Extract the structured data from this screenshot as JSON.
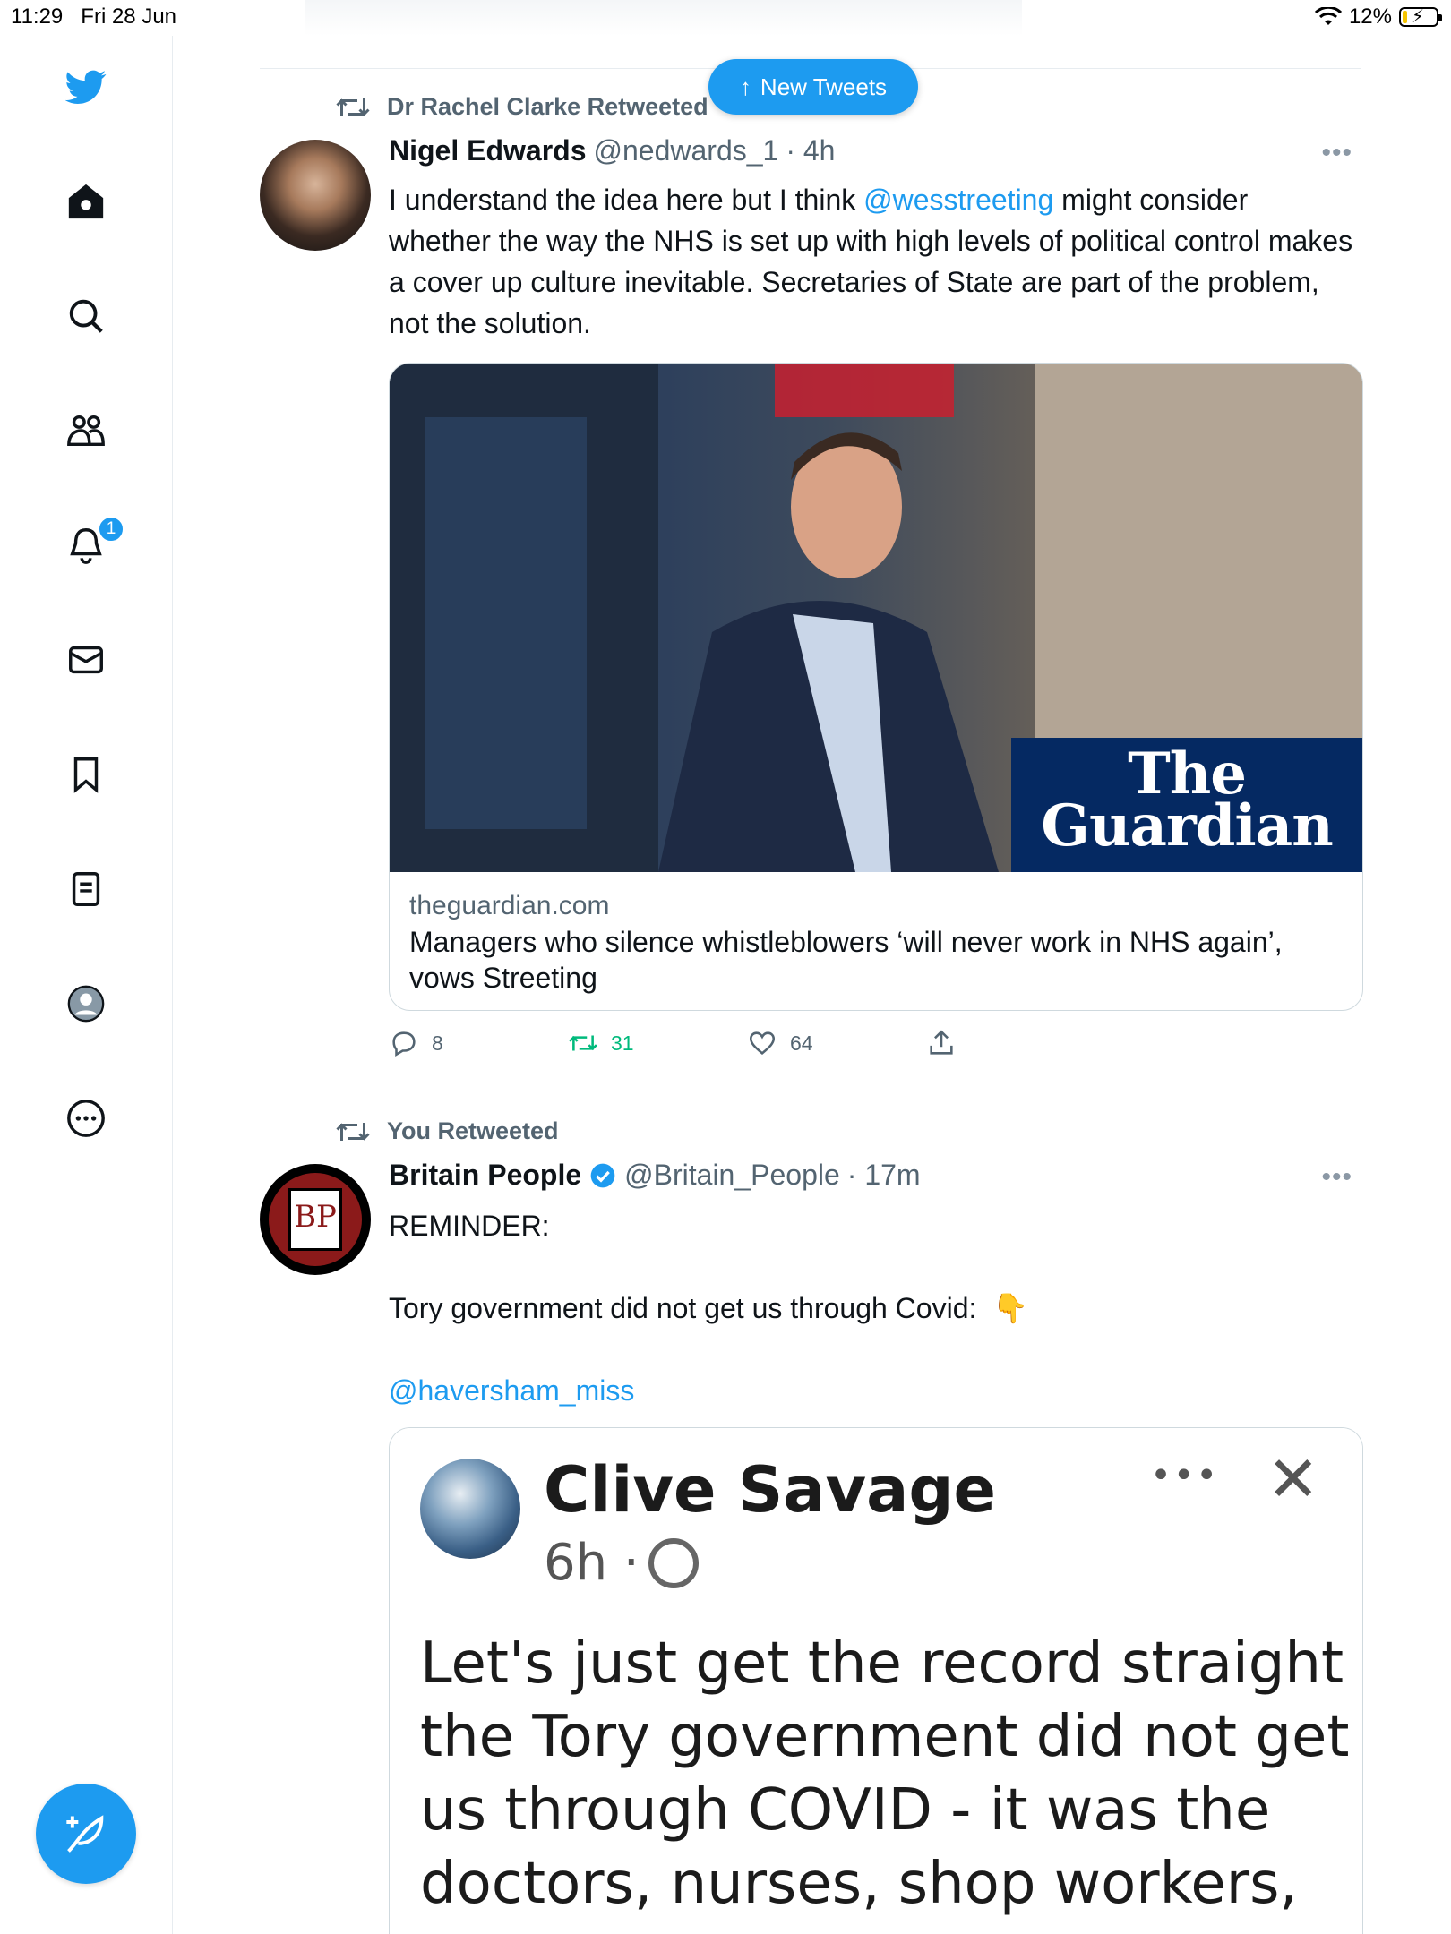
{
  "status_bar": {
    "time": "11:29",
    "date": "Fri 28 Jun",
    "battery": "12%",
    "battery_level": 0.12
  },
  "sidebar": {
    "items": [
      {
        "name": "twitter-logo",
        "icon": "twitter-bird"
      },
      {
        "name": "home",
        "icon": "home-icon"
      },
      {
        "name": "explore",
        "icon": "search-icon"
      },
      {
        "name": "communities",
        "icon": "people-icon"
      },
      {
        "name": "notifications",
        "icon": "bell-icon",
        "badge": "1"
      },
      {
        "name": "messages",
        "icon": "mail-icon"
      },
      {
        "name": "bookmarks",
        "icon": "bookmark-icon"
      },
      {
        "name": "lists",
        "icon": "list-icon"
      },
      {
        "name": "profile",
        "icon": "avatar-icon"
      },
      {
        "name": "more",
        "icon": "more-circle-icon"
      }
    ],
    "compose_icon": "compose-feather-icon"
  },
  "new_tweets": {
    "label": "New Tweets",
    "icon": "arrow-up-icon"
  },
  "tweets": [
    {
      "retweet_by": "Dr Rachel Clarke Retweeted",
      "name": "Nigel Edwards",
      "handle": "@nedwards_1",
      "time": "· 4h",
      "text_before": "I understand the idea here but I think ",
      "mention": "@wesstreeting",
      "text_after": " might consider whether the way the NHS is set up with high levels of political control makes a cover up culture inevitable.  Secretaries of State are part of the problem, not the solution.",
      "card": {
        "domain": "theguardian.com",
        "title": "Managers who silence whistleblowers ‘will never work in NHS again’, vows Streeting",
        "logo_line1": "The",
        "logo_line2": "Guardian"
      },
      "replies": "8",
      "retweets": "31",
      "likes": "64"
    },
    {
      "retweet_by": "You Retweeted",
      "name": "Britain People",
      "handle": "@Britain_People",
      "time": "· 17m",
      "avatar_text": "BP",
      "line1": "REMINDER:",
      "line2": "Tory government did not get us through Covid:",
      "emoji": "👇",
      "mention": "@haversham_miss",
      "embed": {
        "name": "Clive Savage",
        "time": "6h ·",
        "dots": "•••",
        "close": "✕",
        "text": "Let's just get the record straight the Tory government did not get us through COVID - it was the doctors, nurses, shop workers,"
      }
    }
  ],
  "colors": {
    "accent": "#1d9bf0",
    "retweet_green": "#00ba7c",
    "secondary_text": "#536471",
    "guardian_blue": "#052962"
  }
}
